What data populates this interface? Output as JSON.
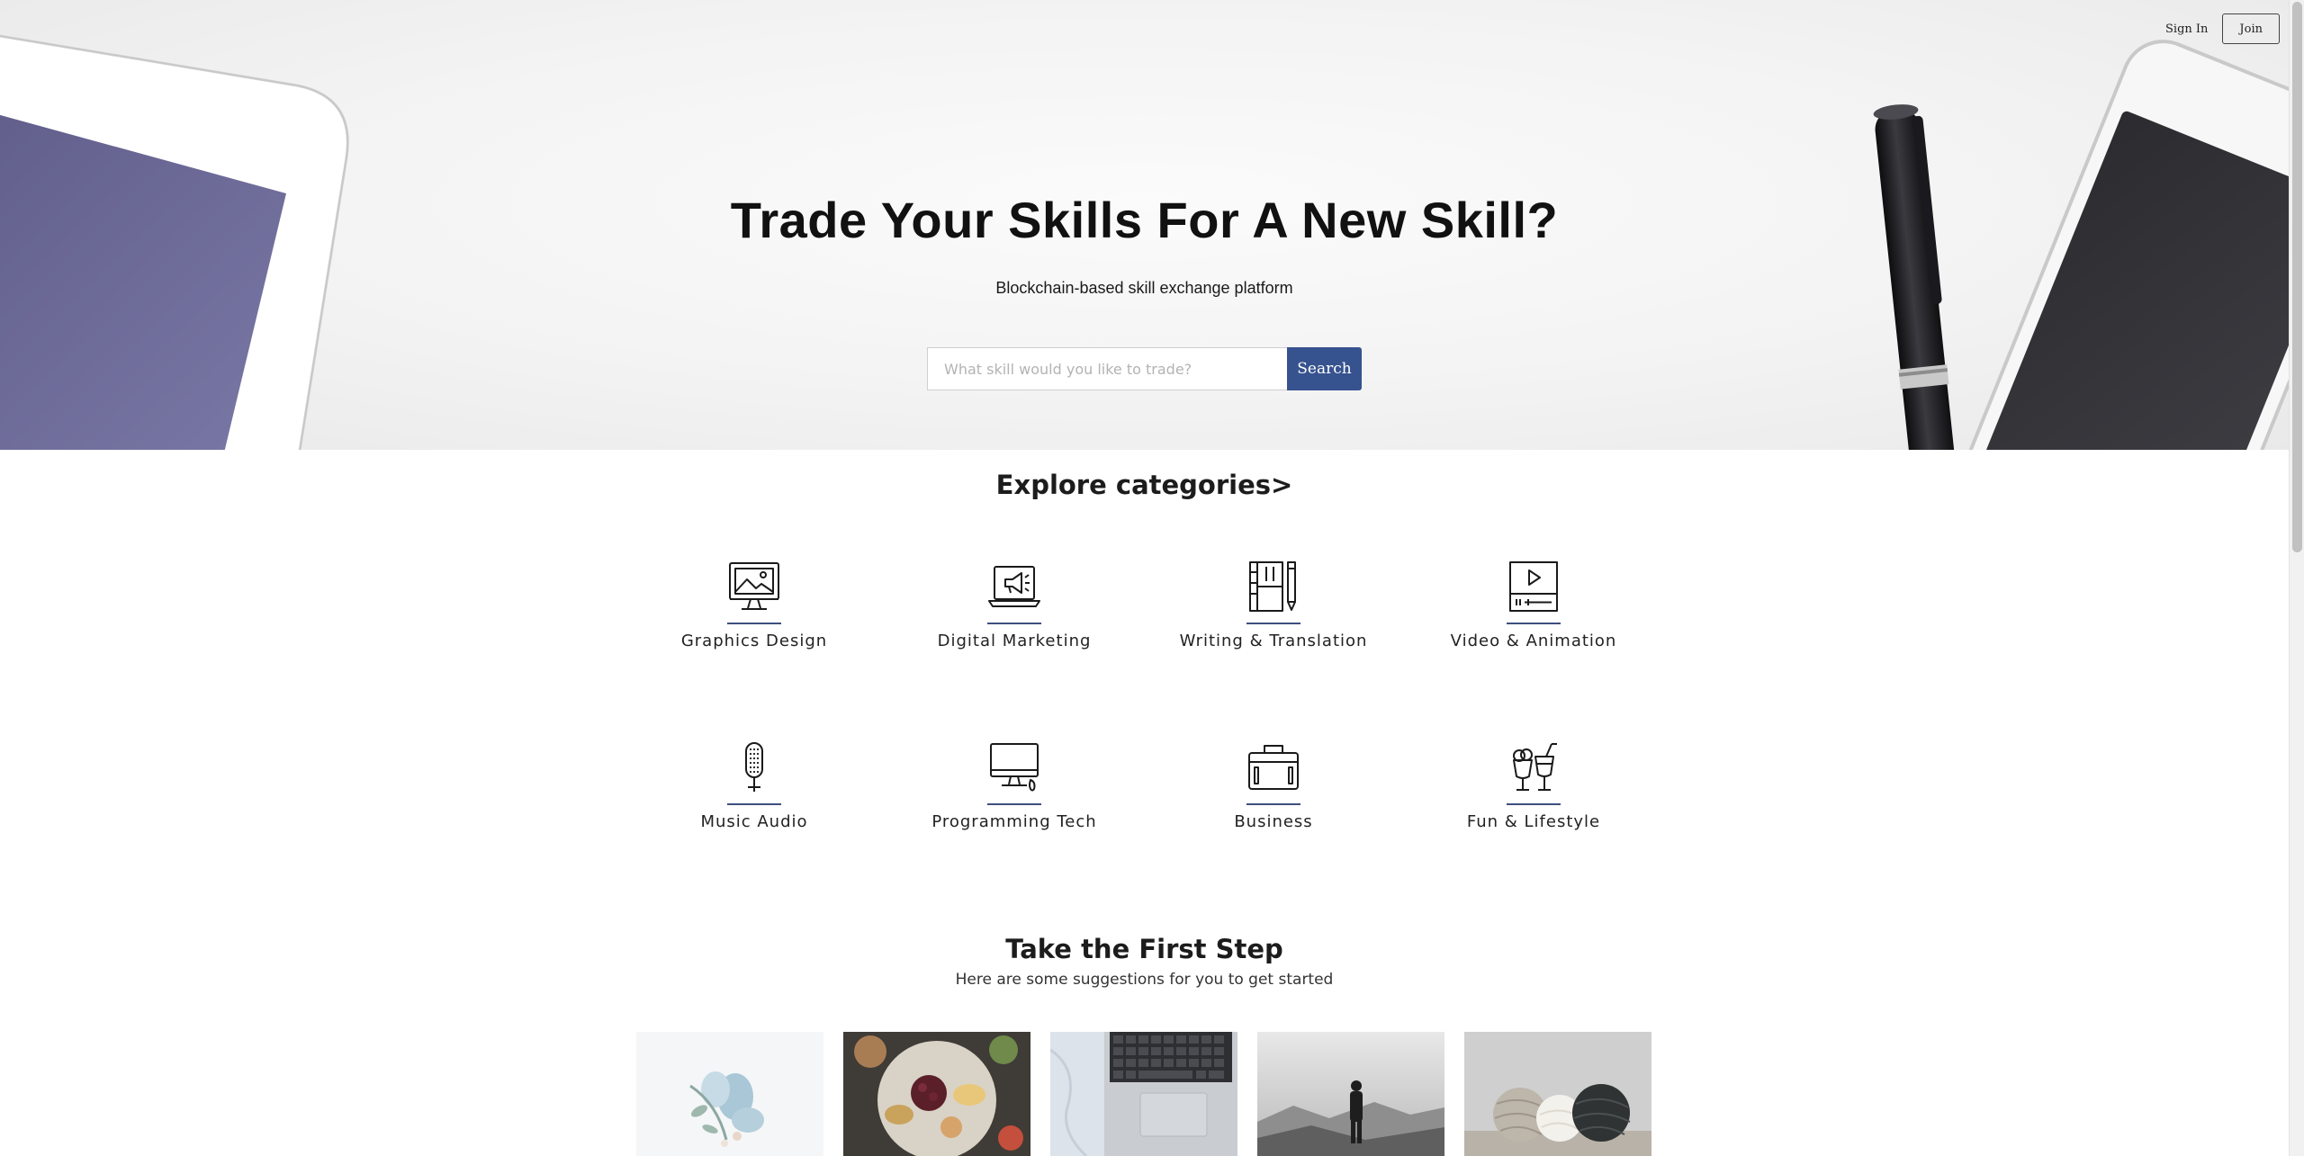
{
  "nav": {
    "sign_in": "Sign In",
    "join": "Join"
  },
  "hero": {
    "title": "Trade Your Skills For A New Skill?",
    "subtitle": "Blockchain-based skill exchange platform",
    "search_placeholder": "What skill would you like to trade?",
    "search_button": "Search"
  },
  "categories": {
    "title": "Explore categories>",
    "accent_color": "#3d4f7e",
    "items": [
      {
        "label": "Graphics Design",
        "icon": "monitor-image-icon"
      },
      {
        "label": "Digital Marketing",
        "icon": "laptop-megaphone-icon"
      },
      {
        "label": "Writing & Translation",
        "icon": "notebook-pen-icon"
      },
      {
        "label": "Video & Animation",
        "icon": "video-player-icon"
      },
      {
        "label": "Music Audio",
        "icon": "microphone-icon"
      },
      {
        "label": "Programming Tech",
        "icon": "desktop-computer-icon"
      },
      {
        "label": "Business",
        "icon": "briefcase-icon"
      },
      {
        "label": "Fun & Lifestyle",
        "icon": "drinks-icon"
      }
    ]
  },
  "first_step": {
    "title": "Take the First Step",
    "subtitle": "Here are some suggestions for you to get started",
    "suggestions": [
      {
        "image": "flowers-photo"
      },
      {
        "image": "food-platter-photo"
      },
      {
        "image": "laptop-keyboard-photo"
      },
      {
        "image": "mountain-hiker-photo"
      },
      {
        "image": "yarn-balls-photo"
      }
    ]
  },
  "colors": {
    "search_button": "#37538f",
    "text": "#1a1a1a"
  }
}
